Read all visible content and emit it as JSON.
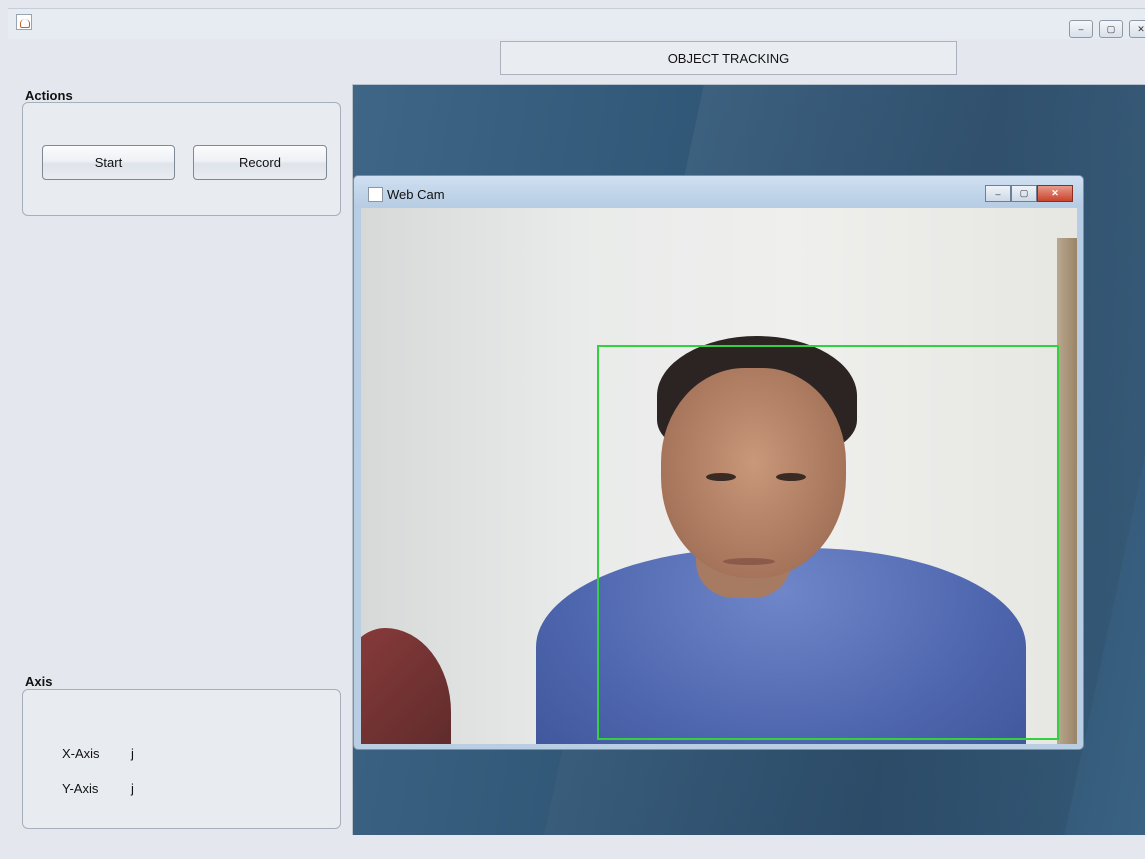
{
  "window": {
    "controls": {
      "minimize": "–",
      "maximize": "▢",
      "close": "✕"
    }
  },
  "header": {
    "title": "OBJECT TRACKING"
  },
  "actions": {
    "label": "Actions",
    "start_label": "Start",
    "record_label": "Record"
  },
  "axis": {
    "label": "Axis",
    "x_label": "X-Axis",
    "x_value": "j",
    "y_label": "Y-Axis",
    "y_value": "j"
  },
  "webcam": {
    "title": "Web Cam",
    "controls": {
      "minimize": "–",
      "maximize": "▢",
      "close": "✕"
    },
    "tracking_box_color": "#33d040"
  },
  "colors": {
    "desktop": "#315777",
    "panel": "#e8ebf0"
  }
}
